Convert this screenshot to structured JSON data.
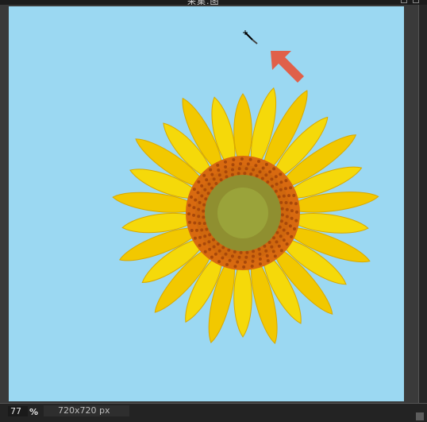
{
  "window": {
    "title": "采集.图"
  },
  "statusbar": {
    "zoom_value": "77",
    "zoom_unit": "%",
    "dimensions": "720x720 px"
  },
  "canvas": {
    "background_color": "#9bd8f2",
    "image": "sunflower",
    "annotation": "red-arrow"
  },
  "colors": {
    "arrow": "#e0604a",
    "petal": "#f5d90a",
    "center_ring": "#d86a10",
    "center_core": "#9aa33a"
  }
}
